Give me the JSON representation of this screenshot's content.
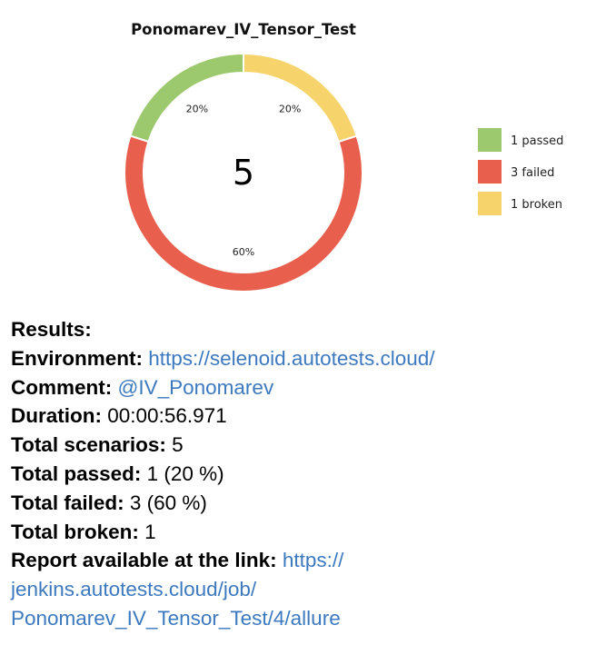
{
  "colors": {
    "passed": "#9cc96d",
    "failed": "#e8604d",
    "broken": "#f6d36b",
    "link": "#3c79bf"
  },
  "chart_data": {
    "type": "pie",
    "title": "Ponomarev_IV_Tensor_Test",
    "center_label": "5",
    "slices": [
      {
        "name": "1 passed",
        "value": 1,
        "label": "20%",
        "color": "#9cc96d"
      },
      {
        "name": "3 failed",
        "value": 3,
        "label": "60%",
        "color": "#e8604d"
      },
      {
        "name": "1 broken",
        "value": 1,
        "label": "20%",
        "color": "#f6d36b"
      }
    ],
    "legend_position": "right"
  },
  "report": {
    "results_label": "Results:",
    "environment": {
      "label": "Environment:",
      "value": "https://selenoid.autotests.cloud/"
    },
    "comment": {
      "label": "Comment:",
      "value": "@IV_Ponomarev"
    },
    "duration": {
      "label": "Duration:",
      "value": "00:00:56.971"
    },
    "total_scenarios": {
      "label": "Total scenarios:",
      "value": "5"
    },
    "total_passed": {
      "label": "Total passed:",
      "value": "1 (20 %)"
    },
    "total_failed": {
      "label": "Total failed:",
      "value": "3 (60 %)"
    },
    "total_broken": {
      "label": "Total broken:",
      "value": "1"
    },
    "report_link": {
      "label": "Report available at the link:",
      "line1": "https://",
      "line2": "jenkins.autotests.cloud/job/",
      "line3": "Ponomarev_IV_Tensor_Test/4/allure"
    }
  }
}
